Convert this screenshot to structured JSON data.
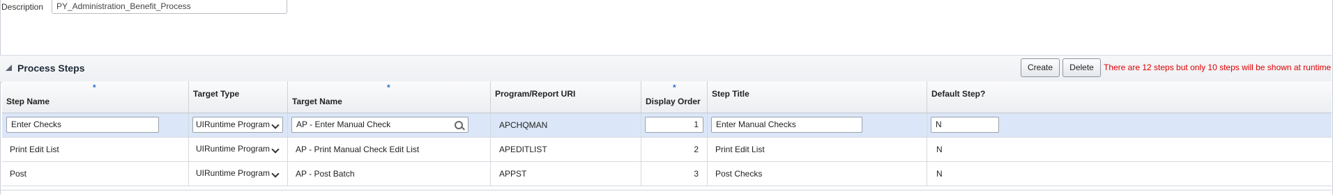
{
  "description": {
    "label": "Description",
    "value": "PY_Administration_Benefit_Process"
  },
  "section": {
    "title": "Process Steps",
    "create_label": "Create",
    "delete_label": "Delete",
    "warning": "There are 12 steps but only 10 steps will be shown at runtime"
  },
  "columns": {
    "step_name": "Step Name",
    "target_type": "Target Type",
    "target_name": "Target Name",
    "program_uri": "Program/Report URI",
    "display_order": "Display Order",
    "step_title": "Step Title",
    "default_step": "Default Step?",
    "required_mark": "*"
  },
  "rows": [
    {
      "step_name": "Enter Checks",
      "target_type": "UIRuntime Program",
      "target_name": "AP - Enter Manual Check",
      "program_uri": "APCHQMAN",
      "display_order": "1",
      "step_title": "Enter Manual Checks",
      "default_step": "N"
    },
    {
      "step_name": "Print Edit List",
      "target_type": "UIRuntime Program",
      "target_name": "AP - Print Manual Check Edit List",
      "program_uri": "APEDITLIST",
      "display_order": "2",
      "step_title": "Print Edit List",
      "default_step": "N"
    },
    {
      "step_name": "Post",
      "target_type": "UIRuntime Program",
      "target_name": "AP - Post Batch",
      "program_uri": "APPST",
      "display_order": "3",
      "step_title": "Post Checks",
      "default_step": "N"
    }
  ],
  "colors": {
    "selected_row": "#dbe7f8",
    "warning": "#e00000",
    "required": "#2a6fd0"
  },
  "icons": {
    "collapse": "collapse-triangle-icon",
    "search": "search-icon",
    "dropdown": "chevron-down-icon"
  }
}
